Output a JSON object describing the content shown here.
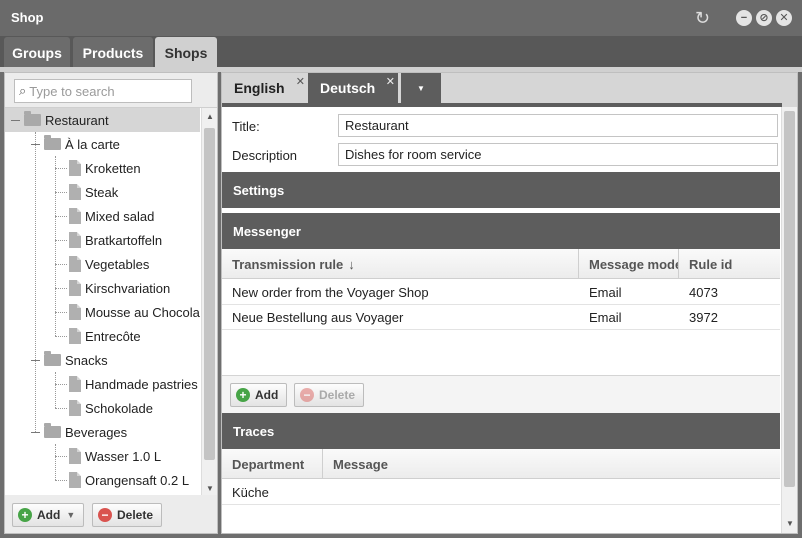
{
  "window": {
    "title": "Shop",
    "icons": [
      "refresh-icon",
      "minimize-icon",
      "restore-icon",
      "close-icon"
    ]
  },
  "main_tabs": [
    {
      "label": "Groups",
      "active": false
    },
    {
      "label": "Products",
      "active": false
    },
    {
      "label": "Shops",
      "active": true
    }
  ],
  "left": {
    "search": {
      "placeholder": "Type to search",
      "value": ""
    },
    "tree": [
      {
        "label": "Restaurant",
        "type": "folder",
        "level": 0,
        "selected": true
      },
      {
        "label": "À la carte",
        "type": "folder",
        "level": 1
      },
      {
        "label": "Kroketten",
        "type": "doc",
        "level": 2
      },
      {
        "label": "Steak",
        "type": "doc",
        "level": 2
      },
      {
        "label": "Mixed salad",
        "type": "doc",
        "level": 2
      },
      {
        "label": "Bratkartoffeln",
        "type": "doc",
        "level": 2
      },
      {
        "label": "Vegetables",
        "type": "doc",
        "level": 2
      },
      {
        "label": "Kirschvariation",
        "type": "doc",
        "level": 2
      },
      {
        "label": "Mousse au Chocolat",
        "type": "doc",
        "level": 2
      },
      {
        "label": "Entrecôte",
        "type": "doc",
        "level": 2
      },
      {
        "label": "Snacks",
        "type": "folder",
        "level": 1
      },
      {
        "label": "Handmade pastries",
        "type": "doc",
        "level": 2
      },
      {
        "label": "Schokolade",
        "type": "doc",
        "level": 2
      },
      {
        "label": "Beverages",
        "type": "folder",
        "level": 1
      },
      {
        "label": "Wasser 1.0 L",
        "type": "doc",
        "level": 2
      },
      {
        "label": "Orangensaft 0.2 L",
        "type": "doc",
        "level": 2
      }
    ],
    "add_label": "Add",
    "delete_label": "Delete"
  },
  "right": {
    "lang_tabs": [
      {
        "label": "English",
        "active": false
      },
      {
        "label": "Deutsch",
        "active": true
      }
    ],
    "fields": {
      "title_label": "Title:",
      "title_value": "Restaurant",
      "description_label": "Description",
      "description_value": "Dishes for room service"
    },
    "settings_title": "Settings",
    "messenger": {
      "title": "Messenger",
      "columns": [
        "Transmission rule",
        "Message mode",
        "Rule id"
      ],
      "sort_indicator": "↓",
      "rows": [
        [
          "New order from the Voyager Shop",
          "Email",
          "4073"
        ],
        [
          "Neue Bestellung aus Voyager",
          "Email",
          "3972"
        ]
      ],
      "add_label": "Add",
      "delete_label": "Delete"
    },
    "traces": {
      "title": "Traces",
      "columns": [
        "Department",
        "Message"
      ],
      "rows": [
        [
          "Küche",
          ""
        ]
      ]
    }
  }
}
